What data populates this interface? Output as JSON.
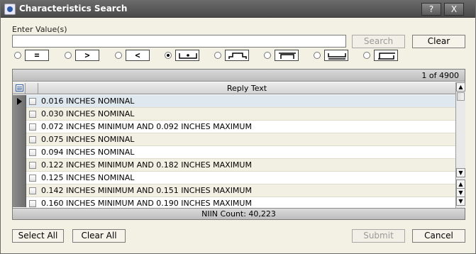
{
  "window": {
    "title": "Characteristics Search",
    "help_label": "?",
    "close_label": "X"
  },
  "search": {
    "enter_label": "Enter Value(s)",
    "value": "",
    "search_label": "Search",
    "clear_label": "Clear"
  },
  "operators": [
    {
      "name": "equals",
      "glyph": "=",
      "checked": false
    },
    {
      "name": "greater-than",
      "glyph": ">",
      "checked": false
    },
    {
      "name": "less-than",
      "glyph": "<",
      "checked": false
    },
    {
      "name": "nominal",
      "glyph": "",
      "checked": true
    },
    {
      "name": "range",
      "glyph": "",
      "checked": false
    },
    {
      "name": "maximum",
      "glyph": "",
      "checked": false
    },
    {
      "name": "minimum",
      "glyph": "",
      "checked": false
    },
    {
      "name": "min-max",
      "glyph": "",
      "checked": false
    }
  ],
  "grid": {
    "page_count": "1 of 4900",
    "header": "Reply Text",
    "niin_count": "NIIN Count: 40,223",
    "rows": [
      {
        "text": "0.016 INCHES NOMINAL",
        "selected": true
      },
      {
        "text": "0.030 INCHES NOMINAL",
        "selected": false
      },
      {
        "text": "0.072 INCHES MINIMUM AND 0.092 INCHES MAXIMUM",
        "selected": false
      },
      {
        "text": "0.075 INCHES NOMINAL",
        "selected": false
      },
      {
        "text": "0.094 INCHES NOMINAL",
        "selected": false
      },
      {
        "text": "0.122 INCHES MINIMUM AND 0.182 INCHES MAXIMUM",
        "selected": false
      },
      {
        "text": "0.125 INCHES NOMINAL",
        "selected": false
      },
      {
        "text": "0.142 INCHES MINIMUM AND 0.151 INCHES MAXIMUM",
        "selected": false
      },
      {
        "text": "0.160 INCHES MINIMUM AND 0.190 INCHES MAXIMUM",
        "selected": false
      }
    ]
  },
  "footer": {
    "select_all_label": "Select All",
    "clear_all_label": "Clear All",
    "submit_label": "Submit",
    "cancel_label": "Cancel"
  }
}
